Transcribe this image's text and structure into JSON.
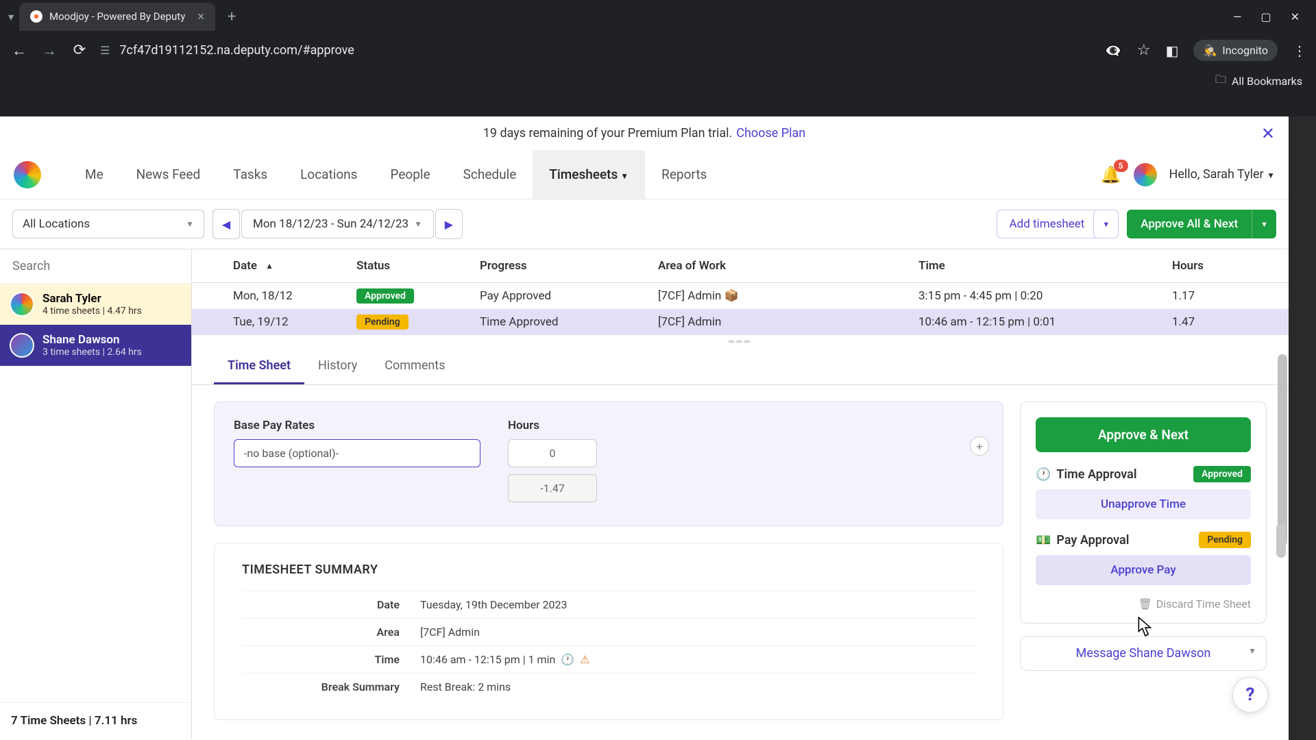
{
  "browser": {
    "tab_title": "Moodjoy - Powered By Deputy",
    "url": "7cf47d19112152.na.deputy.com/#approve",
    "incognito_label": "Incognito",
    "all_bookmarks": "All Bookmarks"
  },
  "trial": {
    "text": "19 days remaining of your Premium Plan trial.",
    "link": "Choose Plan"
  },
  "nav": {
    "items": [
      "Me",
      "News Feed",
      "Tasks",
      "Locations",
      "People",
      "Schedule",
      "Timesheets",
      "Reports"
    ],
    "active_index": 6,
    "bell_count": "5",
    "greeting": "Hello, Sarah Tyler"
  },
  "toolbar": {
    "location": "All Locations",
    "date_range": "Mon 18/12/23 - Sun 24/12/23",
    "add_timesheet": "Add timesheet",
    "approve_all": "Approve All & Next"
  },
  "sidebar": {
    "search_placeholder": "Search",
    "employees": [
      {
        "name": "Sarah Tyler",
        "meta": "4 time sheets | 4.47 hrs",
        "selected": true
      },
      {
        "name": "Shane Dawson",
        "meta": "3 time sheets | 2.64 hrs",
        "selected": false
      }
    ],
    "footer": "7 Time Sheets | 7.11 hrs"
  },
  "table": {
    "headers": {
      "date": "Date",
      "status": "Status",
      "progress": "Progress",
      "area": "Area of Work",
      "time": "Time",
      "hours": "Hours"
    },
    "rows": [
      {
        "date": "Mon, 18/12",
        "status": "Approved",
        "status_class": "approved",
        "progress": "Pay Approved",
        "area": "[7CF] Admin 📦",
        "time": "3:15 pm - 4:45 pm | 0:20",
        "hours": "1.17",
        "selected": false
      },
      {
        "date": "Tue, 19/12",
        "status": "Pending",
        "status_class": "pending",
        "progress": "Time Approved",
        "area": "[7CF] Admin",
        "time": "10:46 am - 12:15 pm | 0:01",
        "hours": "1.47",
        "selected": true
      }
    ]
  },
  "detail_tabs": {
    "items": [
      "Time Sheet",
      "History",
      "Comments"
    ],
    "active_index": 0
  },
  "pay_card": {
    "base_label": "Base Pay Rates",
    "base_value": "-no base (optional)-",
    "hours_label": "Hours",
    "hours_value": "0",
    "hours_diff": "-1.47"
  },
  "summary": {
    "title": "TIMESHEET SUMMARY",
    "rows": [
      {
        "key": "Date",
        "val": "Tuesday, 19th December 2023"
      },
      {
        "key": "Area",
        "val": "[7CF] Admin"
      },
      {
        "key": "Time",
        "val": "10:46 am - 12:15 pm | 1 min",
        "warn": true
      },
      {
        "key": "Break Summary",
        "val": "Rest Break: 2 mins"
      }
    ]
  },
  "side_panel": {
    "approve_next": "Approve & Next",
    "time_approval_label": "Time Approval",
    "time_approval_status": "Approved",
    "unapprove_time": "Unapprove Time",
    "pay_approval_label": "Pay Approval",
    "pay_approval_status": "Pending",
    "approve_pay": "Approve Pay",
    "discard": "Discard Time Sheet",
    "message": "Message Shane Dawson"
  }
}
